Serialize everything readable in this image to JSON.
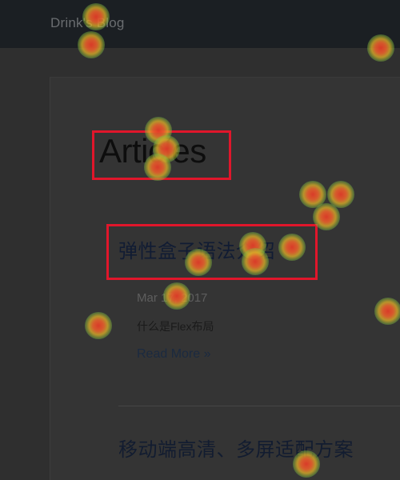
{
  "navbar": {
    "brand": "Drink's Blog"
  },
  "main": {
    "page_title": "Articles",
    "articles": [
      {
        "title": "弹性盒子语法介绍",
        "date": "Mar 17, 2017",
        "excerpt": "什么是Flex布局",
        "read_more": "Read More »"
      },
      {
        "title": "移动端高清、多屏适配方案"
      }
    ]
  },
  "colors": {
    "highlight_box": "#e0162b",
    "navbar_background": "#1b1f23",
    "page_overlay": "#2f2f2f"
  },
  "heatmap": {
    "fixation_count": 20
  }
}
